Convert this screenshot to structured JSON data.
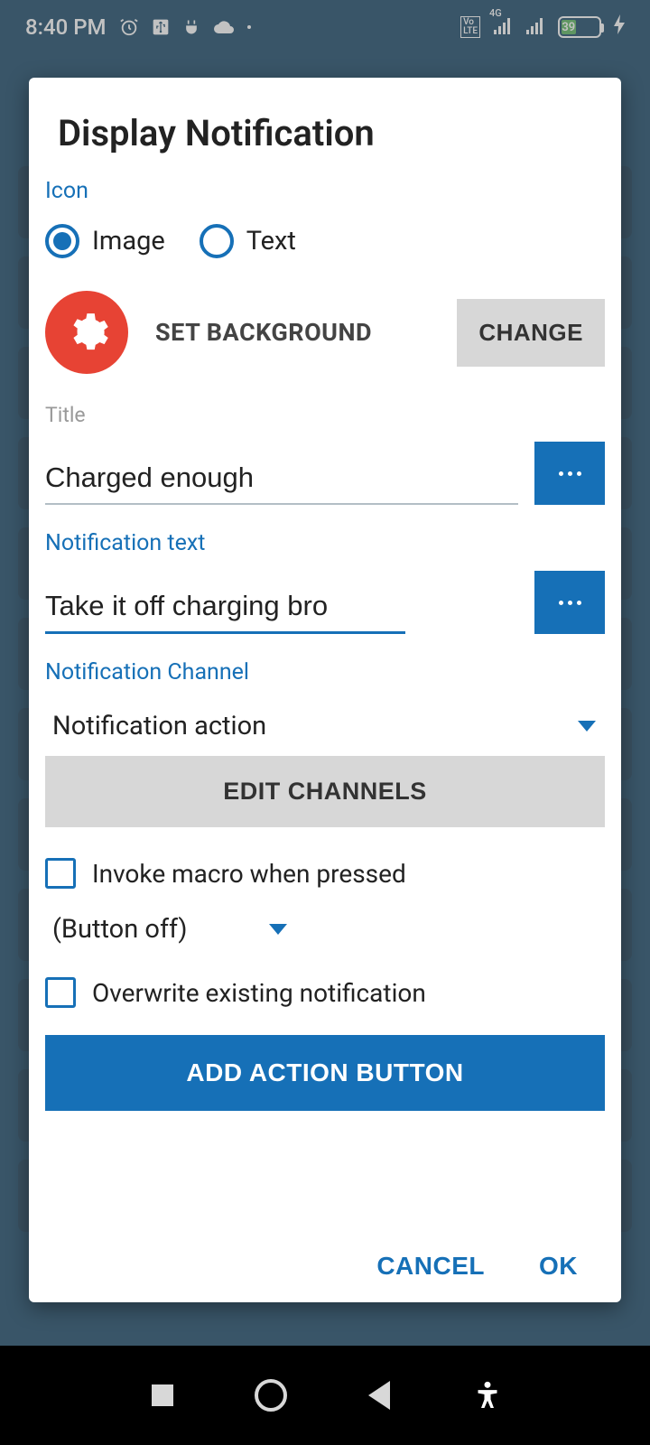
{
  "statusbar": {
    "time": "8:40 PM",
    "battery_pct": "39"
  },
  "dialog": {
    "title": "Display Notification",
    "icon_section": "Icon",
    "radio_image": "Image",
    "radio_text": "Text",
    "set_background": "SET BACKGROUND",
    "change": "CHANGE",
    "title_label": "Title",
    "title_value": "Charged enough",
    "notif_text_label": "Notification text",
    "notif_text_value": "Take it off charging bro",
    "channel_label": "Notification Channel",
    "channel_value": "Notification action",
    "edit_channels": "EDIT CHANNELS",
    "invoke_macro": "Invoke macro when pressed",
    "button_off": "(Button off)",
    "overwrite": "Overwrite existing notification",
    "add_action": "ADD ACTION BUTTON",
    "cancel": "CANCEL",
    "ok": "OK"
  }
}
